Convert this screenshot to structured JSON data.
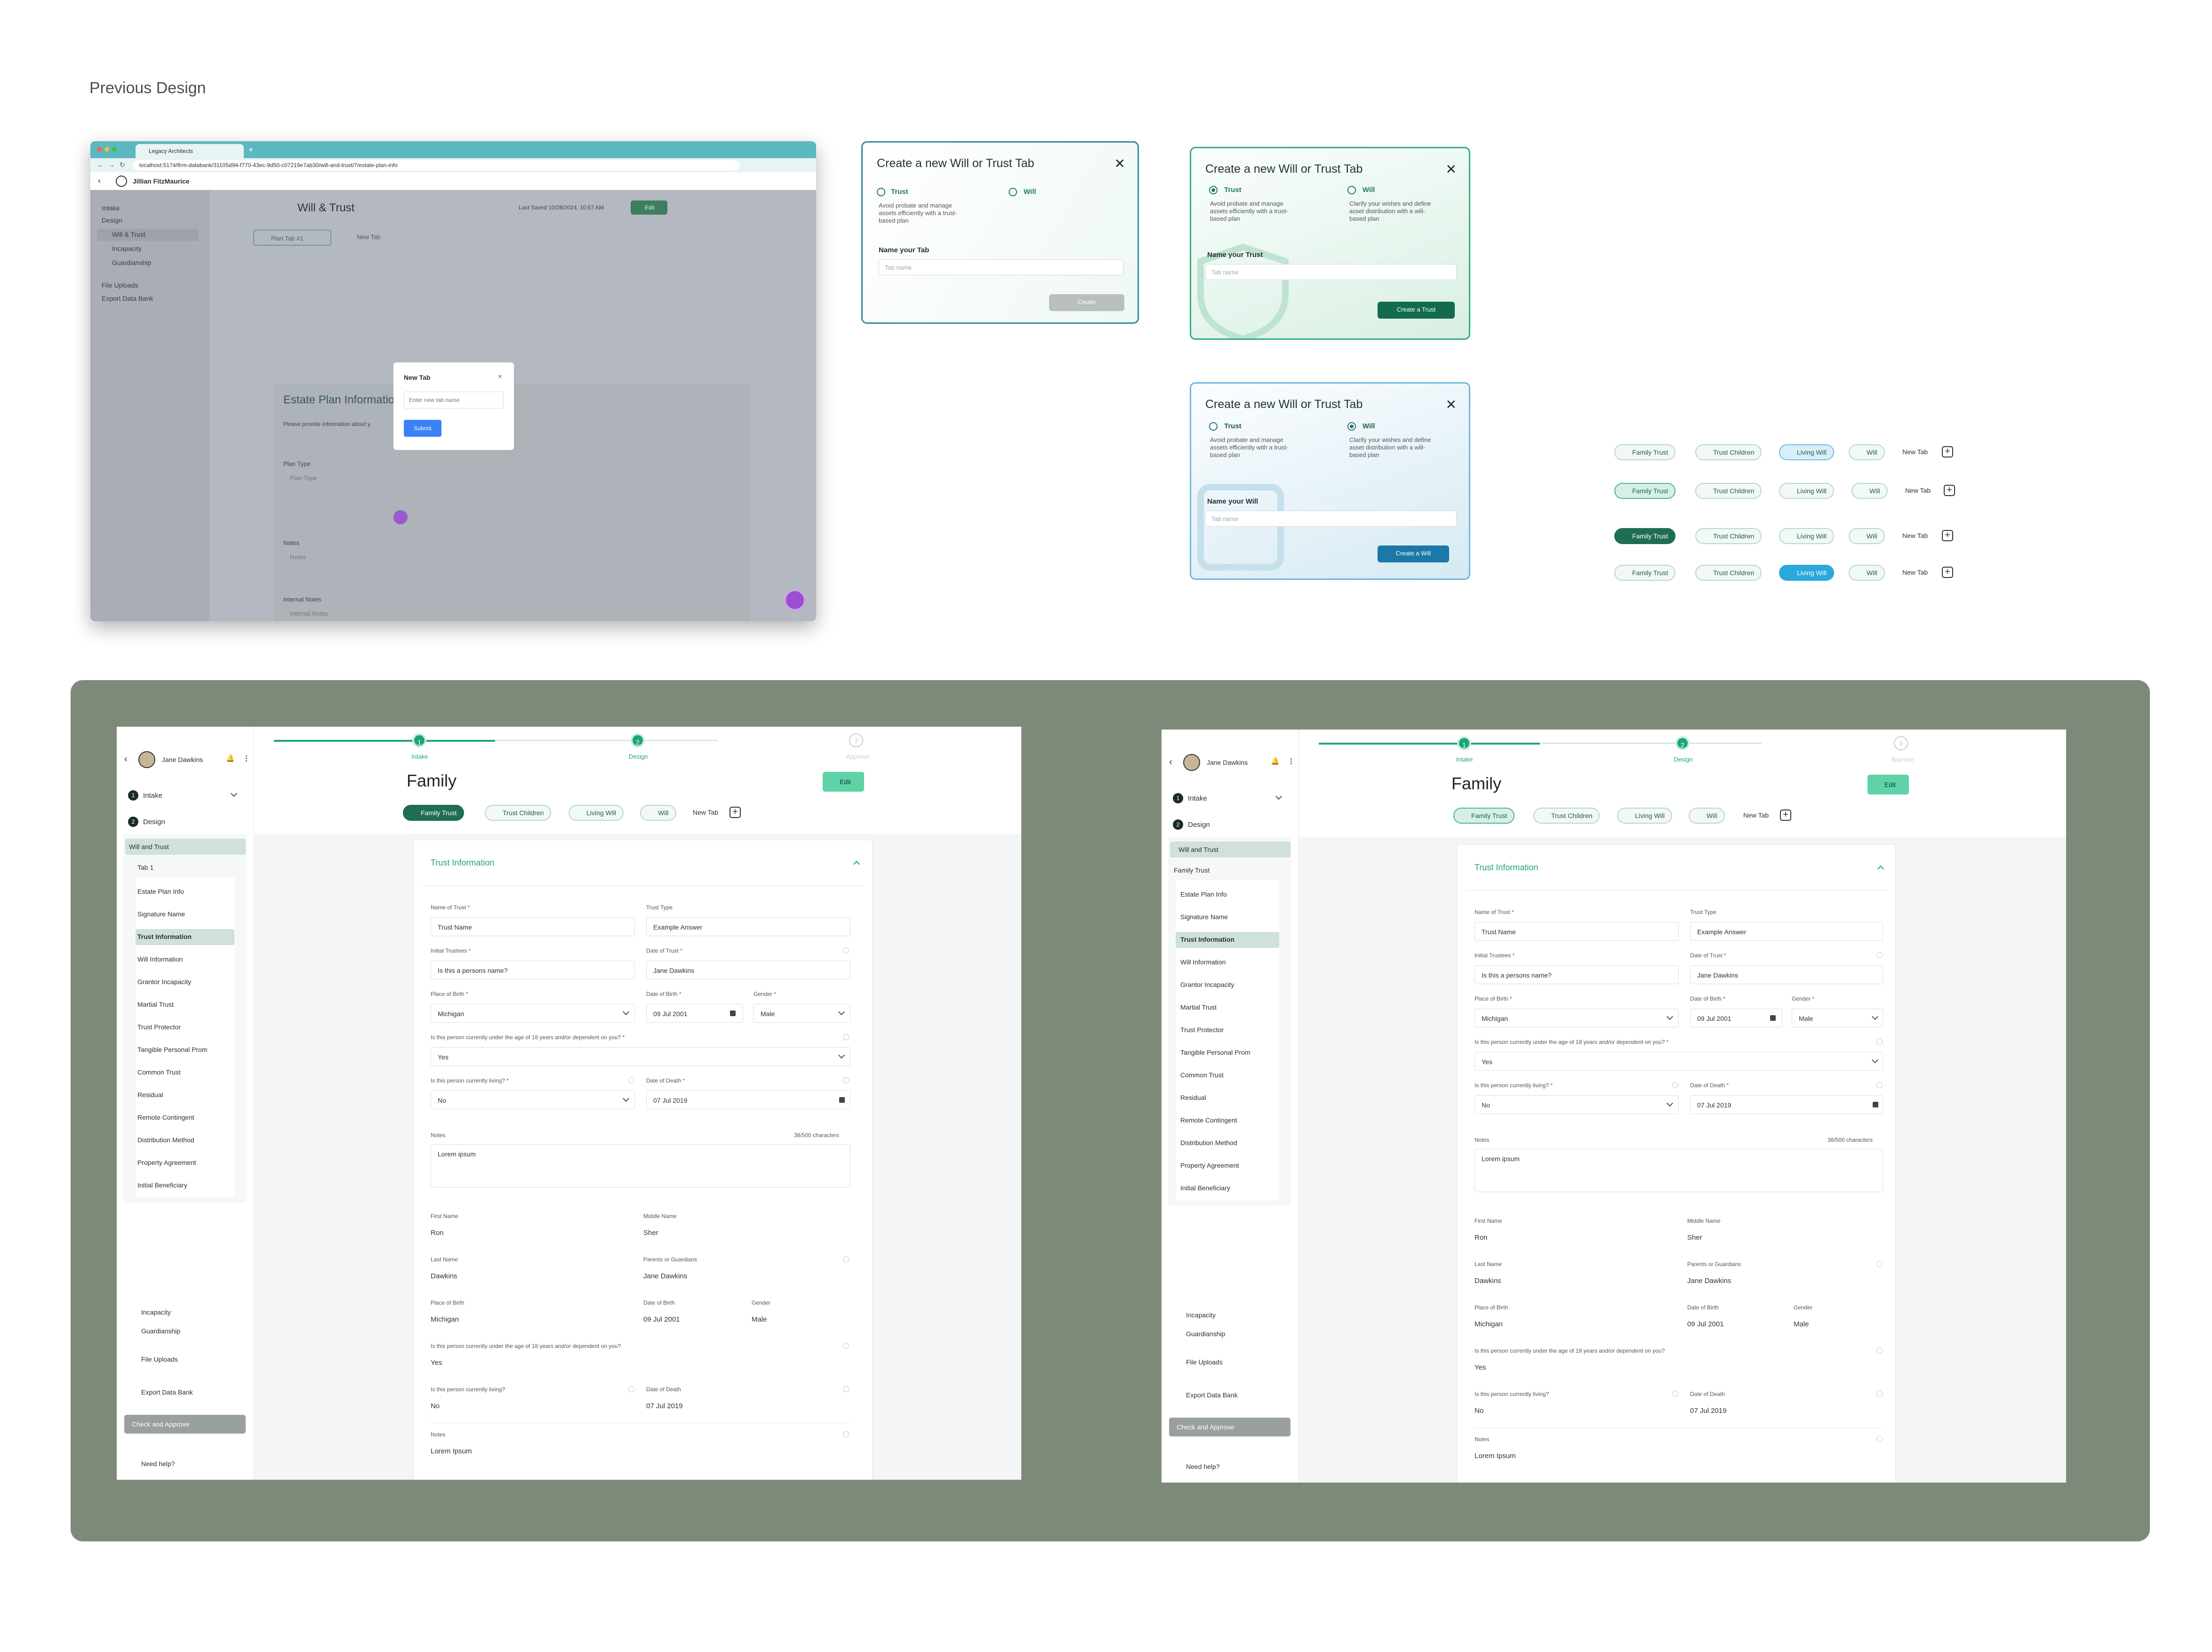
{
  "page_title": "Previous Design",
  "browser": {
    "tab_title": "Legacy Architects",
    "url": "localhost:5174/firm-databank/31105d94-f770-43ec-9d50-c07219e7ab30/will-and-trust/7/estate-plan-info",
    "user": "Jillian FitzMaurice",
    "sidebar": [
      "Intake",
      "Design",
      "Will & Trust",
      "Incapacity",
      "Guardianship",
      "File Uploads",
      "Export Data Bank"
    ],
    "heading": "Will & Trust",
    "last_saved": "Last Saved 10/28/2024, 10:57 AM",
    "edit": "Edit",
    "plan_tab": "Plan Tab #1",
    "new_tab": "New Tab",
    "section_title": "Estate Plan Information",
    "section_desc": "Please provide information about y",
    "plan_type_label": "Plan Type",
    "plan_type_ph": "Plan Type",
    "notes_label": "Notes",
    "notes_ph": "Notes",
    "internal_notes_label": "Internal Notes",
    "internal_notes_ph": "Internal Notes",
    "modal": {
      "title": "New Tab",
      "placeholder": "Enter new tab name",
      "submit": "Submit"
    }
  },
  "dialog_a": {
    "title": "Create a new Will or Trust Tab",
    "opt1": "Trust",
    "opt1_desc": "Avoid probate and manage assets efficiently with a trust-based plan",
    "opt2": "Will",
    "field": "Name your Tab",
    "placeholder": "Tab name",
    "button": "Create"
  },
  "dialog_b": {
    "title": "Create a new Will or Trust Tab",
    "opt1": "Trust",
    "opt1_desc": "Avoid probate and manage assets efficiently with a trust-based plan",
    "opt2": "Will",
    "opt2_desc": "Clarify your wishes and define asset distribution with a will-based plan",
    "field": "Name your Trust",
    "placeholder": "Tab name",
    "button": "Create a Trust"
  },
  "dialog_c": {
    "title": "Create a new Will or Trust Tab",
    "opt1": "Trust",
    "opt1_desc": "Avoid probate and manage assets efficiently with a trust-based plan",
    "opt2": "Will",
    "opt2_desc": "Clarify your wishes and define asset distribution with a will-based plan",
    "field": "Name your Will",
    "placeholder": "Tab name",
    "button": "Create a Will"
  },
  "chips": {
    "family_trust": "Family Trust",
    "trust_children": "Trust Children",
    "living_will": "Living Will",
    "will": "Will",
    "new_tab": "New Tab"
  },
  "screen": {
    "user": "Jane Dawkins",
    "steps": [
      "Intake",
      "Design",
      "Approve"
    ],
    "title": "Family",
    "edit": "Edit",
    "intake": "Intake",
    "design": "Design",
    "will_and_trust": "Will and Trust",
    "tab1": "Tab 1",
    "family_trust": "Family Trust",
    "subitems": [
      "Estate Plan Info",
      "Signature Name",
      "Trust Information",
      "Will Information",
      "Grantor Incapacity",
      "Martial Trust",
      "Trust Protector",
      "Tangible Personal Prom",
      "Common Trust",
      "Residual",
      "Remote Contingent",
      "Distribution Method",
      "Property Agreement",
      "Initial Beneficiary"
    ],
    "incapacity": "Incapacity",
    "guardianship": "Guardianship",
    "file_uploads": "File Uploads",
    "export": "Export Data Bank",
    "check": "Check and Approve",
    "help": "Need help?",
    "card_title": "Trust Information",
    "name_of_trust": "Name of Trust",
    "name_of_trust_val": "Trust Name",
    "trust_type": "Trust Type",
    "trust_type_val": "Example Answer",
    "initial_trustees": "Initial Trustees",
    "initial_trustees_val": "Is this a persons name?",
    "date_of_trust": "Date of Trust",
    "date_of_trust_val": "Jane Dawkins",
    "place_of_birth": "Place of Birth",
    "place_val": "Michigan",
    "date_of_birth": "Date of Birth",
    "dob_val": "09 Jul 2001",
    "gender": "Gender",
    "gender_val": "Male",
    "under18_q": "Is this person currently under the age of 18 years and/or dependent on you?",
    "yes": "Yes",
    "living_q": "Is this person currently living?",
    "no": "No",
    "date_of_death": "Date of Death",
    "dod_val": "07 Jul 2019",
    "notes": "Notes",
    "chars": "38/500 characters",
    "notes_val": "Lorem ipsum",
    "first_name": "First Name",
    "first_val": "Ron",
    "middle_name": "Middle Name",
    "middle_val": "Sher",
    "last_name": "Last Name",
    "last_val": "Dawkins",
    "parents": "Parents or Guardians",
    "parents_val": "Jane Dawkins",
    "notes2_val": "Lorem Ipsum"
  },
  "colors": {
    "accent": "#1fa575",
    "dark_green": "#1f6e53",
    "panel": "#7e8a79",
    "blue": "#2aa8dc"
  }
}
